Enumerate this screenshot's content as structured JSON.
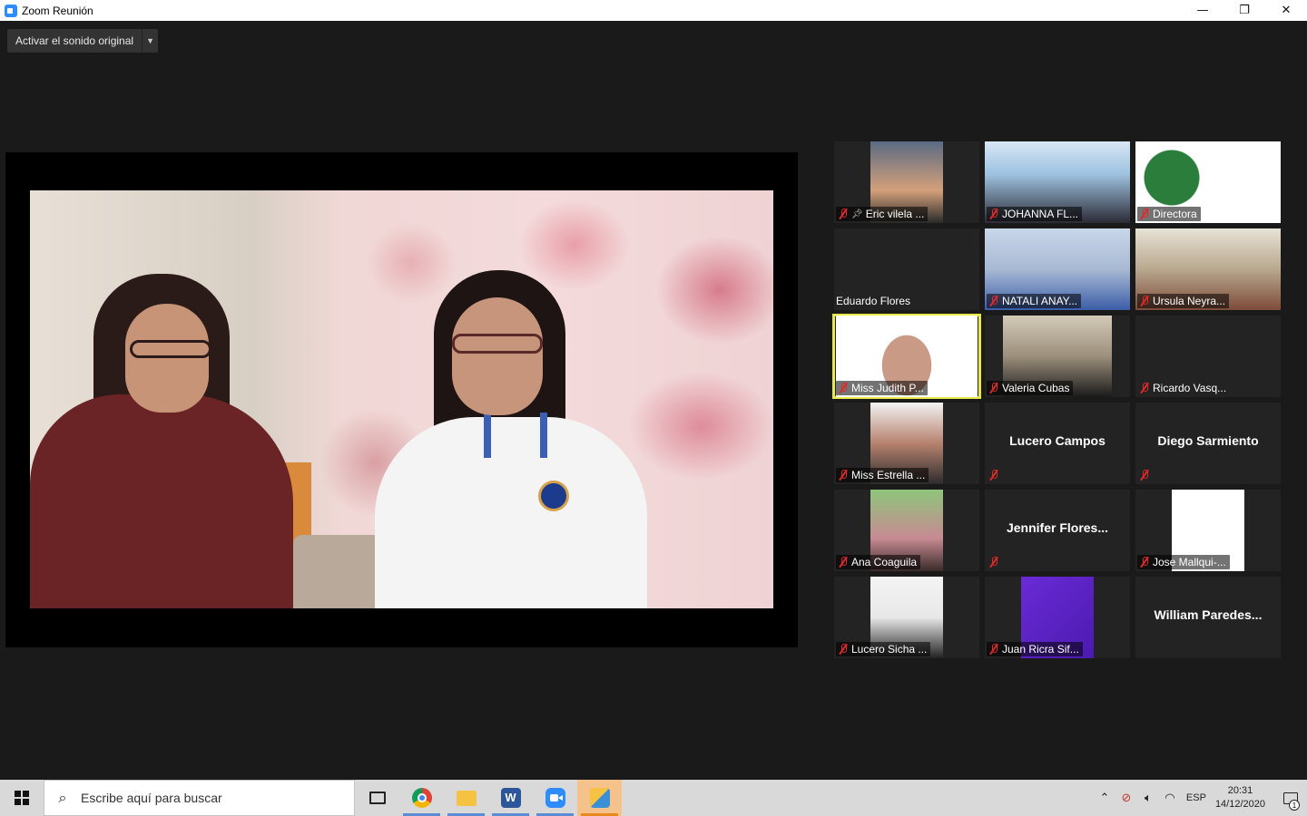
{
  "window": {
    "title": "Zoom Reunión",
    "minimize": "—",
    "maximize": "❐",
    "close": "✕"
  },
  "audio": {
    "original_sound_label": "Activar el sonido original"
  },
  "gallery": {
    "tiles": [
      {
        "name": "Eric vilela ...",
        "muted": true,
        "pinned": true,
        "video": true
      },
      {
        "name": "JOHANNA FL...",
        "muted": true,
        "video": true
      },
      {
        "name": "Directora",
        "muted": true,
        "video": true
      },
      {
        "name": "Eduardo Flores",
        "muted": false,
        "video": false
      },
      {
        "name": "NATALI ANAY...",
        "muted": true,
        "video": true
      },
      {
        "name": "Ursula Neyra...",
        "muted": true,
        "video": true
      },
      {
        "name": "Miss Judith P...",
        "muted": true,
        "video": true,
        "active": true
      },
      {
        "name": "Valeria Cubas",
        "muted": true,
        "video": true
      },
      {
        "name": "Ricardo Vasq...",
        "muted": true,
        "video": false
      },
      {
        "name": "Miss Estrella ...",
        "muted": true,
        "video": true
      },
      {
        "name": "Lucero Campos",
        "muted": true,
        "video": false
      },
      {
        "name": "Diego Sarmiento",
        "muted": true,
        "video": false
      },
      {
        "name": "Ana Coaguila",
        "muted": true,
        "video": true
      },
      {
        "name": "Jennifer  Flores...",
        "muted": true,
        "video": false
      },
      {
        "name": "Jose Mallqui-...",
        "muted": true,
        "video": true
      },
      {
        "name": "Lucero Sicha ...",
        "muted": true,
        "video": true
      },
      {
        "name": "Juan Ricra Sif...",
        "muted": true,
        "video": true
      },
      {
        "name": "William  Paredes...",
        "muted": false,
        "video": false
      }
    ]
  },
  "taskbar": {
    "search_placeholder": "Escribe aquí para buscar",
    "apps": [
      "task-view",
      "chrome",
      "file-explorer",
      "word",
      "zoom",
      "photos"
    ],
    "language": "ESP",
    "time": "20:31",
    "date": "14/12/2020",
    "notification_count": "1"
  },
  "colors": {
    "active_speaker_border": "#e8e84a",
    "muted_red": "#e02828",
    "zoom_blue": "#2d8cff"
  }
}
